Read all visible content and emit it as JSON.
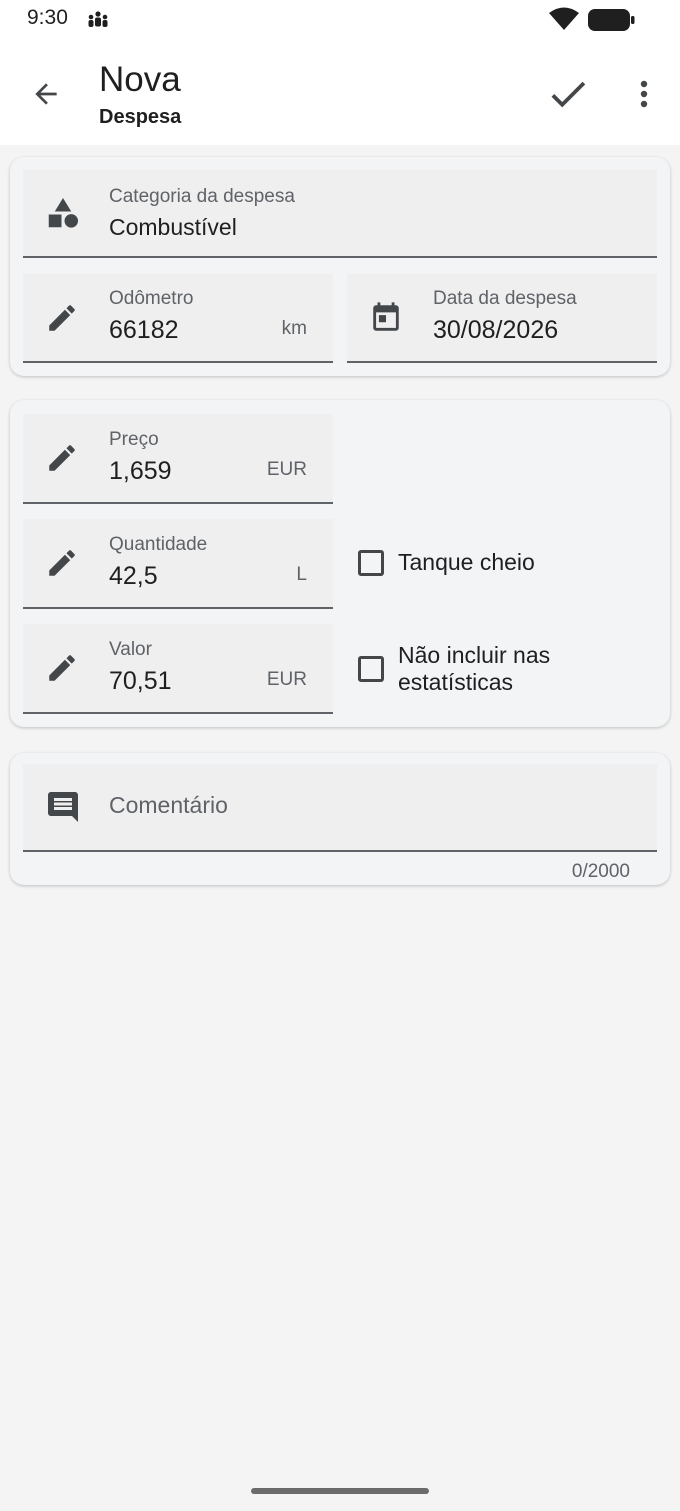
{
  "status_bar": {
    "time": "9:30",
    "icons": [
      "notification-people-icon",
      "wifi-icon",
      "battery-icon"
    ]
  },
  "app_bar": {
    "title": "Nova",
    "subtitle": "Despesa",
    "icons": [
      "back-arrow-icon",
      "checkmark-icon",
      "more-vert-icon"
    ]
  },
  "form": {
    "category": {
      "label": "Categoria da despesa",
      "value": "Combustível",
      "icon": "shapes-icon"
    },
    "odometer": {
      "label": "Odômetro",
      "value": "66182",
      "unit": "km",
      "icon": "pencil-icon"
    },
    "date": {
      "label": "Data da despesa",
      "value": "30/08/2026",
      "icon": "calendar-icon"
    },
    "price": {
      "label": "Preço",
      "value": "1,659",
      "unit": "EUR",
      "icon": "pencil-icon"
    },
    "quantity": {
      "label": "Quantidade",
      "value": "42,5",
      "unit": "L",
      "icon": "pencil-icon"
    },
    "amount": {
      "label": "Valor",
      "value": "70,51",
      "unit": "EUR",
      "icon": "pencil-icon"
    },
    "full_tank": {
      "label": "Tanque cheio",
      "checked": false
    },
    "exclude_stats": {
      "label_line1": "Não incluir nas",
      "label_line2": "estatísticas",
      "checked": false
    },
    "comment": {
      "placeholder": "Comentário",
      "counter": "0/2000",
      "icon": "comment-icon"
    }
  },
  "colors": {
    "background": "#f4f4f4",
    "card": "#f3f4f6",
    "field": "#efefef",
    "icon": "#44474a",
    "label": "#5f6368"
  }
}
